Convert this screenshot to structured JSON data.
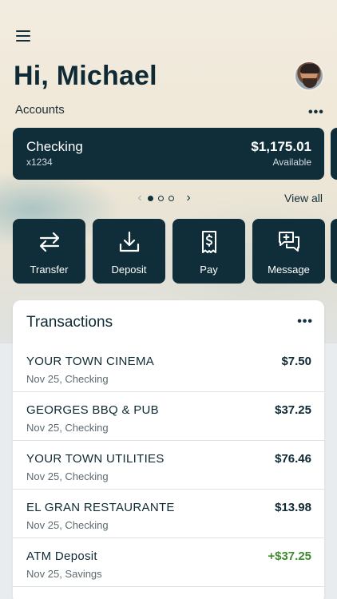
{
  "header": {
    "greeting": "Hi, Michael",
    "accounts_label": "Accounts",
    "more_label": "•••"
  },
  "account": {
    "name": "Checking",
    "number": "x1234",
    "balance": "$1,175.01",
    "balance_label": "Available"
  },
  "carousel": {
    "prev": "‹",
    "next": "›",
    "view_all": "View all",
    "pages": 3,
    "active_page": 1
  },
  "actions": [
    {
      "label": "Transfer",
      "icon": "transfer-icon"
    },
    {
      "label": "Deposit",
      "icon": "deposit-icon"
    },
    {
      "label": "Pay",
      "icon": "bill-pay-icon"
    },
    {
      "label": "Message",
      "icon": "message-icon"
    }
  ],
  "transactions": {
    "title": "Transactions",
    "more_label": "•••",
    "items": [
      {
        "merchant": "YOUR TOWN CINEMA",
        "meta": "Nov 25, Checking",
        "amount": "$7.50"
      },
      {
        "merchant": "GEORGES BBQ & PUB",
        "meta": "Nov 25, Checking",
        "amount": "$37.25"
      },
      {
        "merchant": "YOUR TOWN UTILITIES",
        "meta": "Nov 25, Checking",
        "amount": "$76.46"
      },
      {
        "merchant": "EL GRAN RESTAURANTE",
        "meta": "Nov 25, Checking",
        "amount": "$13.98"
      },
      {
        "merchant": "ATM Deposit",
        "meta": "Nov 25, Savings",
        "amount": "+$37.25"
      }
    ]
  },
  "colors": {
    "primary": "#0f2e3a",
    "credit": "#3e8a2c",
    "text": "#102a35"
  }
}
